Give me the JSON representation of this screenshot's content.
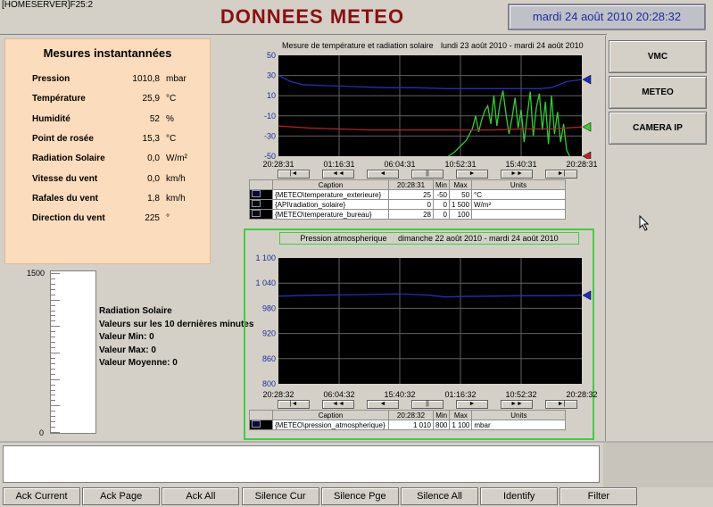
{
  "window": {
    "title": "[HOMESERVER]F25:2"
  },
  "header": {
    "title": "DONNEES METEO",
    "datetime": "mardi 24 août 2010 20:28:32"
  },
  "measures": {
    "title": "Mesures instantannées",
    "rows": [
      {
        "label": "Pression",
        "value": "1010,8",
        "unit": "mbar"
      },
      {
        "label": "Température",
        "value": "25,9",
        "unit": "°C"
      },
      {
        "label": "Humidité",
        "value": "52",
        "unit": "%"
      },
      {
        "label": "Point de rosée",
        "value": "15,3",
        "unit": "°C"
      },
      {
        "label": "Radiation Solaire",
        "value": "0,0",
        "unit": "W/m²"
      },
      {
        "label": "Vitesse du vent",
        "value": "0,0",
        "unit": "km/h"
      },
      {
        "label": "Rafales du vent",
        "value": "1,8",
        "unit": "km/h"
      },
      {
        "label": "Direction du vent",
        "value": "225",
        "unit": "°"
      }
    ]
  },
  "gauge": {
    "max_label": "1500",
    "min_label": "0",
    "level": 0,
    "info": [
      "Radiation Solaire",
      "Valeurs sur les 10 dernières minutes",
      "Valeur Min: 0",
      "Valeur Max: 0",
      "Valeur Moyenne: 0"
    ]
  },
  "chart_data": [
    {
      "type": "line",
      "title": "Mesure de température et radiation solaire",
      "range": "lundi 23 août 2010 - mardi 24 août 2010",
      "yticks": [
        "50",
        "30",
        "10",
        "-10",
        "-30",
        "-50"
      ],
      "ylim": [
        -50,
        50
      ],
      "xticks": [
        "20:28:31",
        "01:16:31",
        "06:04:31",
        "10:52:31",
        "15:40:31",
        "20:28:31"
      ],
      "series": [
        {
          "name": "{METEO\\temperature_exterieure}",
          "color": "#2030c0",
          "x": [
            0,
            0.04,
            0.08,
            0.15,
            0.25,
            0.35,
            0.45,
            0.55,
            0.65,
            0.72,
            0.8,
            0.86,
            0.9,
            0.95,
            1.0
          ],
          "values": [
            30,
            24,
            21,
            20,
            19,
            18,
            18,
            17,
            17,
            17,
            17,
            17,
            18,
            24,
            26
          ]
        },
        {
          "name": "{API\\radiation_solaire}",
          "color": "#30d030",
          "x": [
            0.56,
            0.58,
            0.6,
            0.62,
            0.64,
            0.65,
            0.66,
            0.67,
            0.68,
            0.69,
            0.7,
            0.71,
            0.72,
            0.73,
            0.74,
            0.75,
            0.76,
            0.77,
            0.78,
            0.79,
            0.8,
            0.81,
            0.82,
            0.83,
            0.84,
            0.85,
            0.86,
            0.87,
            0.88,
            0.89,
            0.9,
            0.91,
            0.92,
            0.93,
            0.94,
            0.95,
            0.96
          ],
          "values": [
            -50,
            -46,
            -40,
            -34,
            -22,
            -10,
            -26,
            -14,
            -5,
            0,
            -18,
            10,
            -20,
            2,
            15,
            -8,
            -28,
            -12,
            8,
            -22,
            -4,
            -36,
            -10,
            14,
            -30,
            -2,
            12,
            -24,
            4,
            -38,
            10,
            -28,
            -6,
            -36,
            -18,
            -44,
            -50
          ]
        },
        {
          "name": "{METEO\\temperature_bureau}",
          "color": "#c02020",
          "x": [
            0,
            0.1,
            0.2,
            0.3,
            0.4,
            0.5,
            0.6,
            0.7,
            0.8,
            0.9,
            0.95,
            1.0
          ],
          "values": [
            -20,
            -22,
            -23,
            -24,
            -24,
            -24,
            -24,
            -24,
            -23,
            -23,
            -22,
            -21
          ]
        }
      ]
    },
    {
      "type": "line",
      "title": "Pression atmospherique",
      "range": "dimanche 22 août 2010 - mardi 24 août 2010",
      "yticks": [
        "1 100",
        "1 040",
        "980",
        "920",
        "860",
        "800"
      ],
      "ylim": [
        800,
        1100
      ],
      "xticks": [
        "20:28:32",
        "06:04:32",
        "15:40:32",
        "01:16:32",
        "10:52:32",
        "20:28:32"
      ],
      "series": [
        {
          "name": "{METEO\\pression_atmospherique}",
          "color": "#2030c0",
          "x": [
            0,
            0.1,
            0.2,
            0.3,
            0.4,
            0.45,
            0.5,
            0.55,
            0.6,
            0.7,
            0.8,
            0.9,
            1.0
          ],
          "values": [
            1009,
            1011,
            1012,
            1013,
            1014,
            1013,
            1011,
            1007,
            1008,
            1009,
            1010,
            1010,
            1011
          ]
        }
      ]
    }
  ],
  "legend1": {
    "headers": [
      "Caption",
      "20:28:31",
      "Min",
      "Max",
      "Units"
    ],
    "rows": [
      {
        "caption": "{METEO\\temperature_exterieure}",
        "value": "25",
        "min": "-50",
        "max": "50",
        "unit": "°C",
        "color": "#0a0a30"
      },
      {
        "caption": "{API\\radiation_solaire}",
        "value": "0",
        "min": "0",
        "max": "1 500",
        "unit": "W/m²",
        "color": "#0a0a0a"
      },
      {
        "caption": "{METEO\\temperature_bureau}",
        "value": "28",
        "min": "0",
        "max": "100",
        "unit": "",
        "color": "#0a0a0a"
      }
    ]
  },
  "legend2": {
    "headers": [
      "Caption",
      "20:28:32",
      "Min",
      "Max",
      "Units"
    ],
    "rows": [
      {
        "caption": "{METEO\\pression_atmospherique}",
        "value": "1 010",
        "min": "800",
        "max": "1 100",
        "unit": "mbar",
        "color": "#0a0a30"
      }
    ]
  },
  "nav_buttons": [
    "|◄",
    "◄◄",
    "◄",
    "||",
    "►",
    "►►",
    "►|"
  ],
  "side_buttons": [
    "VMC",
    "METEO",
    "CAMERA IP"
  ],
  "bottom_buttons": [
    "Ack Current",
    "Ack Page",
    "Ack All",
    "Silence Cur",
    "Silence Pge",
    "Silence All",
    "Identify",
    "Filter"
  ]
}
